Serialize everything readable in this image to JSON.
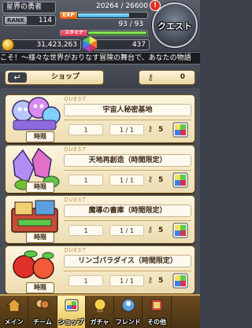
{
  "header": {
    "player_name": "星界の勇者",
    "rank_label": "RANK",
    "rank_value": "114",
    "exp_label": "EXP",
    "exp_text": "20264 / 26600",
    "exp_fraction": 0.76,
    "stamina_label": "スタミナ",
    "stamina_text": "93 / 93",
    "stamina_fraction": 1.0,
    "coins": "31,423,263",
    "gems": "437",
    "quest_button_label": "クエスト",
    "alert_badge": "!"
  },
  "ticker": {
    "text": "こそ！～様々な世界がおりなす冒険の舞台で、あなたの物語"
  },
  "shop_bar": {
    "back_label": "ショップ",
    "keys": "0"
  },
  "quest_tag": "QUEST",
  "quests": [
    {
      "title": "宇宙人秘密基地",
      "count_a": "1",
      "count_b": "1 / 1",
      "key_cost": "5",
      "limited": "時限",
      "art": "aliens"
    },
    {
      "title": "天地再創造（時間限定）",
      "count_a": "1",
      "count_b": "1 / 1",
      "key_cost": "5",
      "limited": "時限",
      "art": "crystal"
    },
    {
      "title": "魔導の書庫（時間限定）",
      "count_a": "1",
      "count_b": "1 / 1",
      "key_cost": "5",
      "limited": "時限",
      "art": "books"
    },
    {
      "title": "リンゴパラダイス（時間限定）",
      "count_a": "1",
      "count_b": "1 / 1",
      "key_cost": "5",
      "limited": "時限",
      "art": "apples"
    }
  ],
  "nav": [
    {
      "label": "メイン",
      "icon": "home-icon",
      "active": false
    },
    {
      "label": "チーム",
      "icon": "team-icon",
      "active": false
    },
    {
      "label": "ショップ",
      "icon": "shop-icon",
      "active": true
    },
    {
      "label": "ガチャ",
      "icon": "gacha-icon",
      "active": false
    },
    {
      "label": "フレンド",
      "icon": "friend-icon",
      "active": false
    },
    {
      "label": "その他",
      "icon": "other-icon",
      "active": false
    }
  ],
  "colors": {
    "accent": "#e25d0c",
    "card_bg": "#fdf5df",
    "nav_active": "#e6c158"
  }
}
